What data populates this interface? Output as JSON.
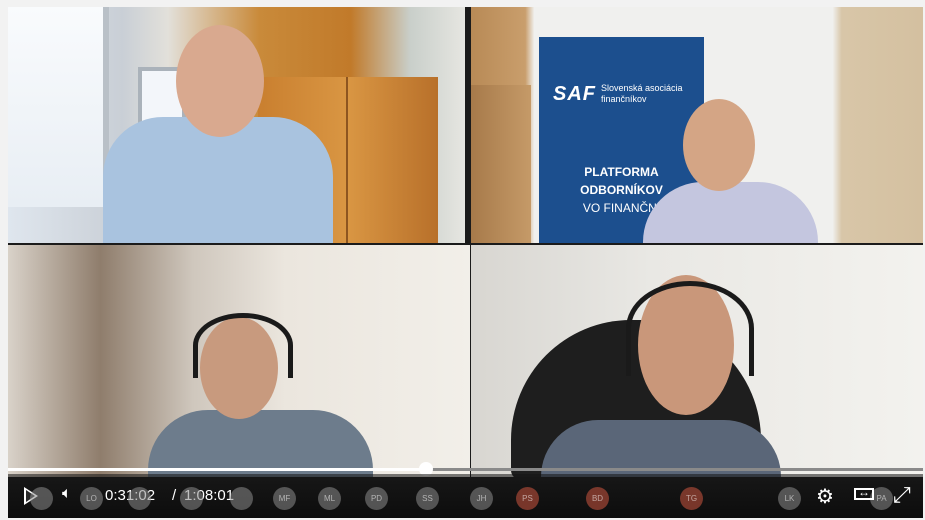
{
  "banner": {
    "logo": "SAF",
    "association": "Slovenská asociácia finančníkov",
    "line1": "PLATFORMA",
    "line2": "ODBORNÍKOV",
    "line3": "VO FINANČNÍ"
  },
  "player": {
    "current_time": "0:31:02",
    "separator": "/",
    "duration": "1:08:01",
    "progress": 0.4563,
    "participants": [
      "",
      "LO",
      "",
      "",
      "",
      "MF",
      "ML",
      "PD",
      "SS",
      "JH",
      "PS",
      "BD",
      "TG",
      "LK",
      "PA"
    ]
  },
  "icons": {
    "play": "play-icon",
    "volume": "volume-icon",
    "settings": "gear-icon",
    "fit": "fit-width-icon",
    "fullscreen": "fullscreen-icon"
  }
}
